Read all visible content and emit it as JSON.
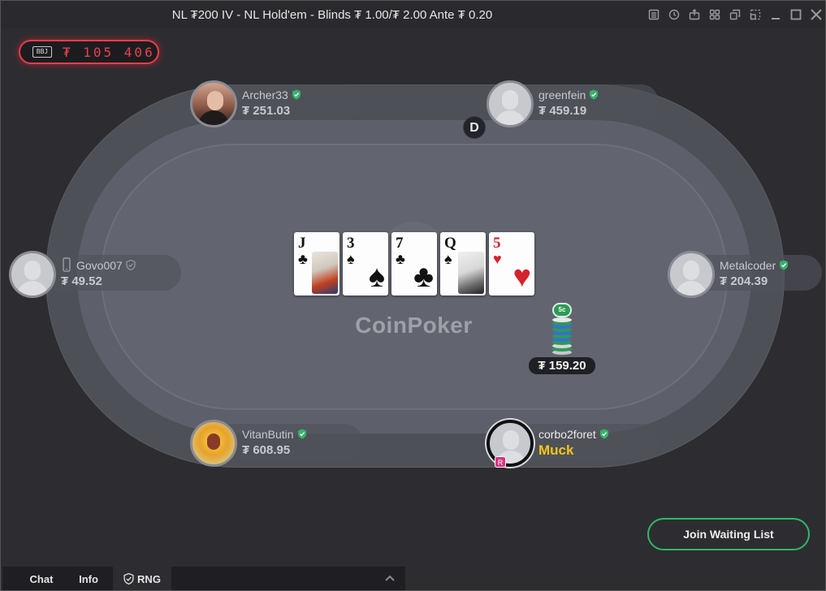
{
  "window": {
    "title": "NL ₮200 IV - NL Hold'em - Blinds ₮ 1.00/₮ 2.00 Ante ₮ 0.20",
    "toolbar_icons": [
      "notes-icon",
      "history-icon",
      "export-icon",
      "grid-view-icon",
      "tile-windows-icon",
      "resize-icon",
      "minimize-icon",
      "maximize-icon",
      "close-icon"
    ]
  },
  "jackpot": {
    "badge": "BBJ",
    "amount": "₮ 105 406"
  },
  "table": {
    "brand": "CoinPoker",
    "dealer_label": "D",
    "board": [
      {
        "rank": "J",
        "suit": "♣",
        "color": "black"
      },
      {
        "rank": "3",
        "suit": "♠",
        "color": "black"
      },
      {
        "rank": "7",
        "suit": "♣",
        "color": "black"
      },
      {
        "rank": "Q",
        "suit": "♠",
        "color": "black"
      },
      {
        "rank": "5",
        "suit": "♥",
        "color": "red"
      }
    ],
    "chip_label": "5c",
    "pot": "₮ 159.20"
  },
  "seats": [
    {
      "name": "Archer33",
      "stack": "₮ 251.03"
    },
    {
      "name": "greenfein",
      "stack": "₮ 459.19"
    },
    {
      "name": "Govo007",
      "stack": "₮ 49.52"
    },
    {
      "name": "Metalcoder",
      "stack": "₮ 204.39"
    },
    {
      "name": "VitanButin",
      "stack": "₮ 608.95"
    }
  ],
  "hero": {
    "name": "corbo2foret",
    "action": "Muck",
    "badge": "R"
  },
  "colors": {
    "accent_green": "#2fb86b",
    "muck_yellow": "#f3c518",
    "jackpot_red": "#e8404c"
  },
  "join_waiting_list": "Join Waiting List",
  "bottom_tabs": {
    "chat": "Chat",
    "info": "Info",
    "rng": "RNG"
  }
}
